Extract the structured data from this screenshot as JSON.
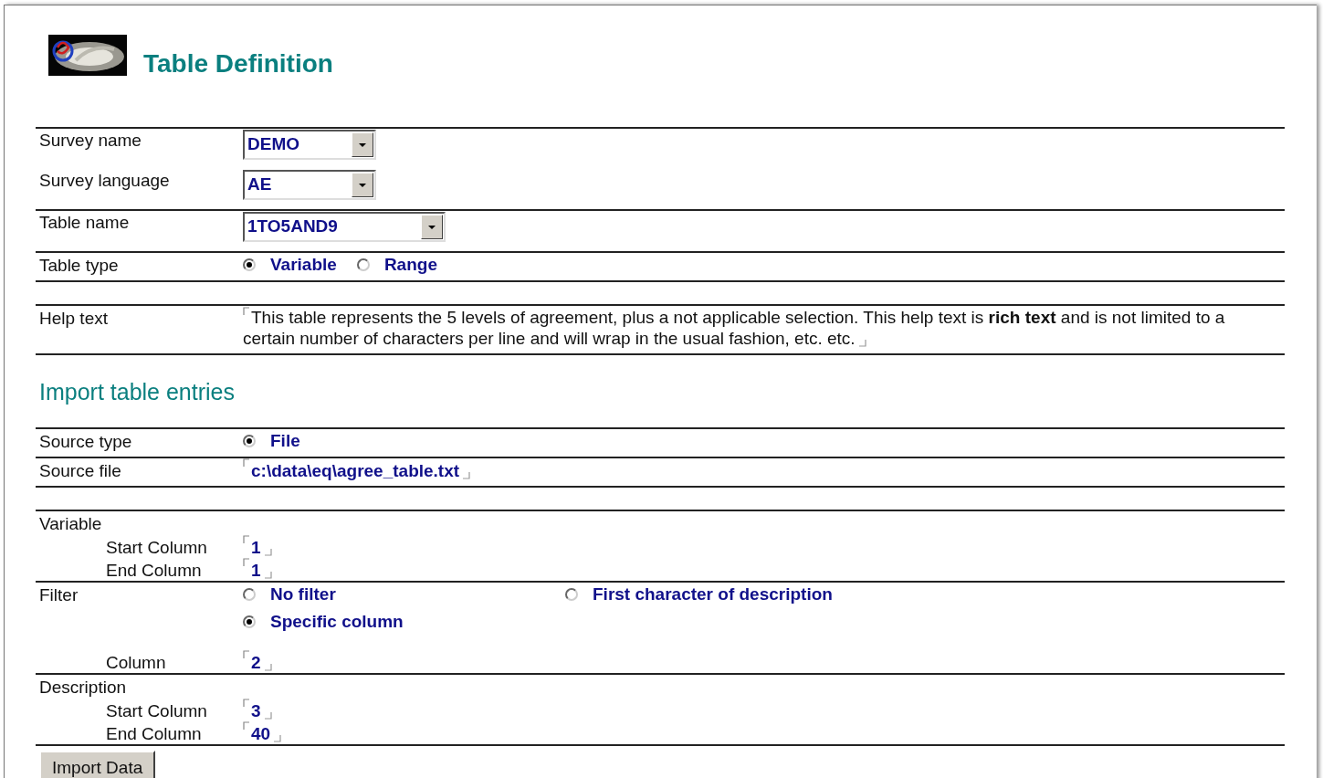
{
  "page": {
    "title": "Table Definition"
  },
  "sections": [
    {
      "groups": [
        {
          "rows": [
            {
              "kind": "select",
              "label": "Survey name",
              "value": "DEMO"
            },
            {
              "kind": "select",
              "label": "Survey language",
              "value": "AE"
            }
          ]
        },
        {
          "rows": [
            {
              "kind": "select",
              "label": "Table name",
              "value": "1TO5AND9"
            }
          ]
        },
        {
          "rows": [
            {
              "kind": "radio",
              "label": "Table type",
              "options": [
                {
                  "label": "Variable",
                  "selected": true
                },
                {
                  "label": "Range",
                  "selected": false
                }
              ]
            }
          ]
        },
        {
          "rows": [
            {
              "kind": "note",
              "label": "Help text",
              "text": "This table represents the 5 levels of agreement, plus a not applicable selection. This help text is **rich text** and is not limited to a certain number of characters per line and will wrap in the usual fashion, etc. etc."
            }
          ]
        }
      ]
    },
    {
      "heading": "Import table entries",
      "groups": [
        {
          "rows": [
            {
              "kind": "radio",
              "label": "Source type",
              "options": [
                {
                  "label": "File",
                  "selected": true
                }
              ]
            }
          ]
        },
        {
          "rows": [
            {
              "kind": "field",
              "label": "Source file",
              "value": "c:\\data\\eq\\agree_table.txt"
            }
          ]
        },
        {
          "rows": [
            {
              "kind": "heading",
              "label": "Variable"
            },
            {
              "kind": "subfield",
              "label": "Start Column",
              "value": "1"
            },
            {
              "kind": "subfield",
              "label": "End Column",
              "value": "1"
            }
          ]
        },
        {
          "rows": [
            {
              "kind": "radio",
              "label": "Filter",
              "options": [
                {
                  "label": "No filter",
                  "selected": false
                },
                {
                  "label": "First character of description",
                  "selected": false
                },
                {
                  "label": "Specific column",
                  "selected": true
                }
              ]
            },
            {
              "kind": "subfield",
              "label": "Column",
              "value": "2"
            }
          ]
        },
        {
          "rows": [
            {
              "kind": "heading",
              "label": "Description"
            },
            {
              "kind": "subfield",
              "label": "Start Column",
              "value": "3"
            },
            {
              "kind": "subfield",
              "label": "End Column",
              "value": "40"
            }
          ]
        }
      ]
    }
  ],
  "button": {
    "label": "Import Data"
  }
}
